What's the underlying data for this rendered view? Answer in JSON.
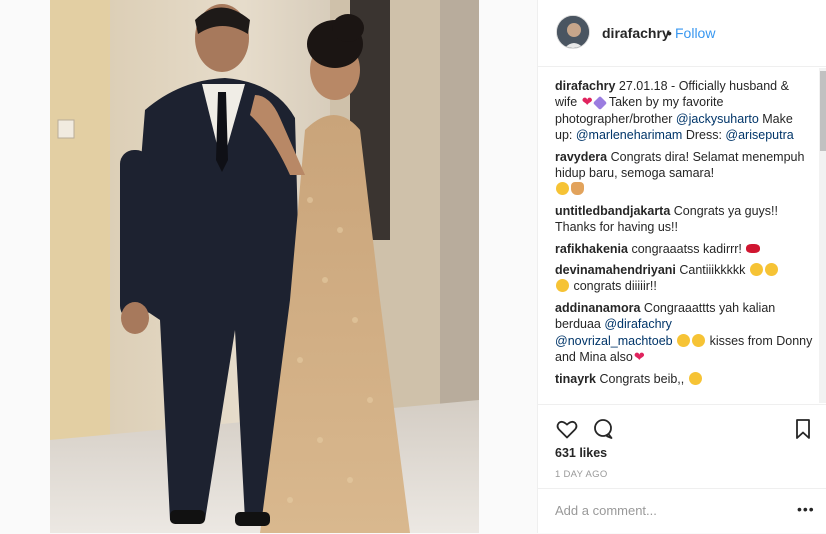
{
  "post": {
    "username": "dirafachry",
    "separator": "•",
    "follow_label": "Follow",
    "caption": {
      "user": "dirafachry",
      "text1": " 27.01.18 - Officially husband & wife ",
      "text2": " Taken by my favorite photographer/brother ",
      "mention1": "@jackysuharto",
      "text3": " Make up: ",
      "mention2": "@marleneharimam",
      "text4": " Dress: ",
      "mention3": "@ariseputra"
    },
    "comments": [
      {
        "user": "ravydera",
        "text": " Congrats dira! Selamat menempuh hidup baru, semoga samara!"
      },
      {
        "user": "untitledbandjakarta",
        "text": " Congrats ya guys!! Thanks for having us!!"
      },
      {
        "user": "rafikhakenia",
        "text": " congraaatss kadirrr!"
      },
      {
        "user": "devinamahendriyani",
        "text": " Cantiiikkkkk",
        "text_b": " congrats diiiiir!!"
      },
      {
        "user": "addinanamora",
        "text": " Congraaattts yah kalian berduaa ",
        "mention1": "@dirafachry",
        "mention2": "@novrizal_machtoeb",
        "text_b": " kisses from Donny and Mina also"
      },
      {
        "user": "tinayrk",
        "text": " Congrats beib,, "
      }
    ],
    "likes": "631 likes",
    "date": "1 DAY AGO",
    "add_comment_placeholder": "Add a comment...",
    "more_label": "•••"
  },
  "icons": {
    "like": "heart-outline-icon",
    "comment": "speech-bubble-icon",
    "save": "bookmark-icon"
  },
  "colors": {
    "link": "#003569",
    "follow": "#3897f0",
    "text": "#262626",
    "muted": "#999999"
  }
}
